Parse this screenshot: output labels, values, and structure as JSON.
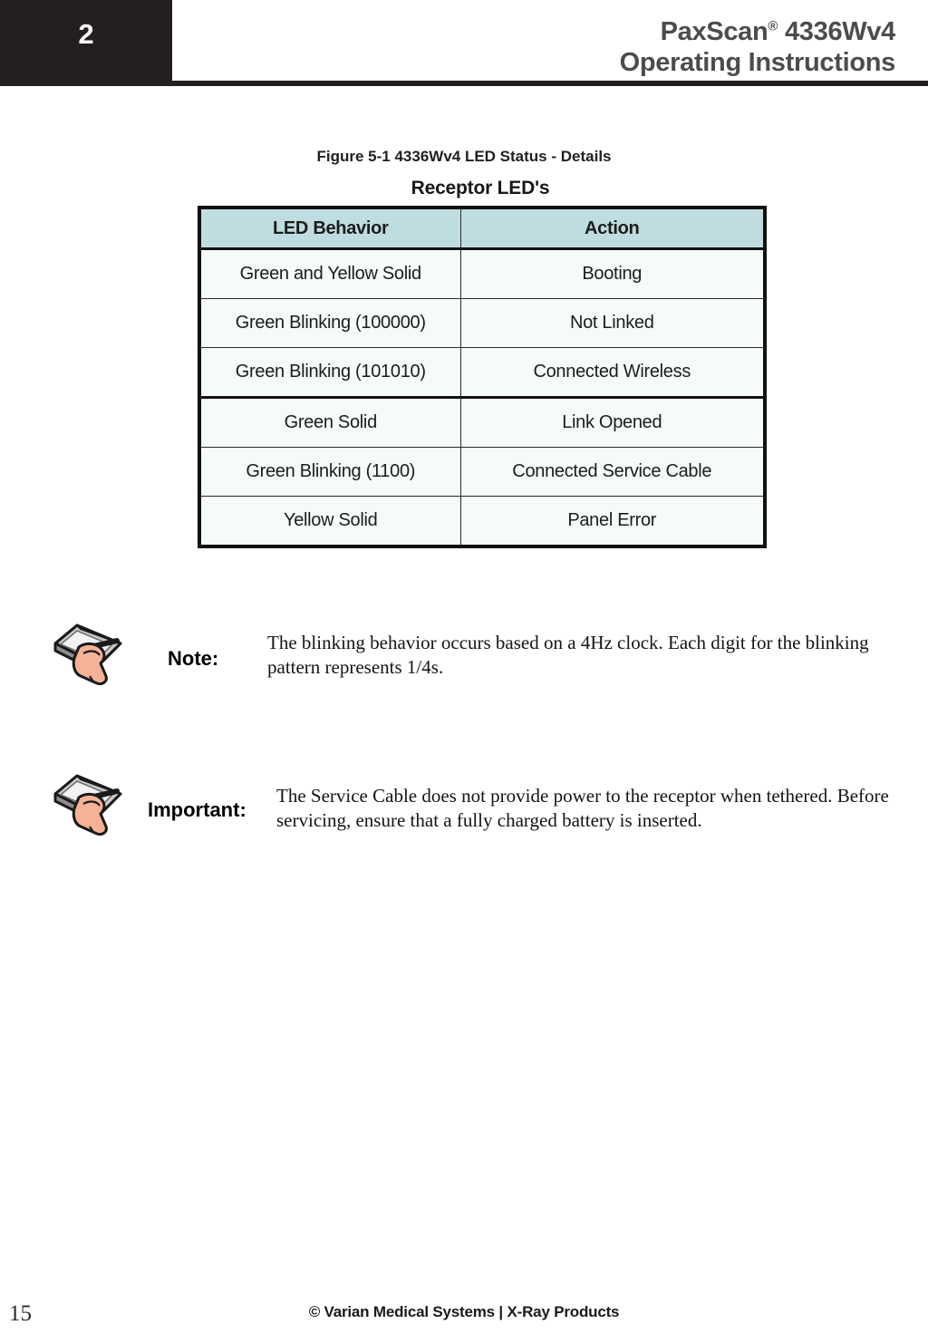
{
  "header": {
    "chapter_number": "2",
    "product_name": "PaxScan",
    "registered_mark": "®",
    "model": "4336Wv4",
    "subtitle": "Operating Instructions"
  },
  "figure": {
    "caption": "Figure 5-1 4336Wv4 LED Status - Details",
    "table_title": "Receptor LED's",
    "colors": {
      "header_fill": "#bfdde0",
      "body_fill": "#f4fbfa",
      "border": "#111111"
    },
    "columns": [
      "LED Behavior",
      "Action"
    ],
    "rows": [
      {
        "behavior": "Green and Yellow Solid",
        "action": "Booting"
      },
      {
        "behavior": "Green Blinking (100000)",
        "action": "Not Linked"
      },
      {
        "behavior": "Green Blinking (101010)",
        "action": "Connected Wireless"
      },
      {
        "behavior": "Green Solid",
        "action": "Link Opened"
      },
      {
        "behavior": "Green Blinking (1100)",
        "action": "Connected Service Cable"
      },
      {
        "behavior": "Yellow Solid",
        "action": "Panel Error"
      }
    ]
  },
  "callouts": [
    {
      "icon": "hand-writing-note-icon",
      "label": "Note:",
      "text": "The blinking behavior occurs based on a 4Hz clock.  Each digit for the blinking pattern represents 1/4s."
    },
    {
      "icon": "hand-writing-note-icon",
      "label": "Important:",
      "text": "The Service Cable does not provide power to the receptor when tethered. Before servicing, ensure that a fully charged battery is inserted."
    }
  ],
  "footer": {
    "page_number": "15",
    "copyright": "© Varian Medical Systems | X-Ray Products"
  }
}
